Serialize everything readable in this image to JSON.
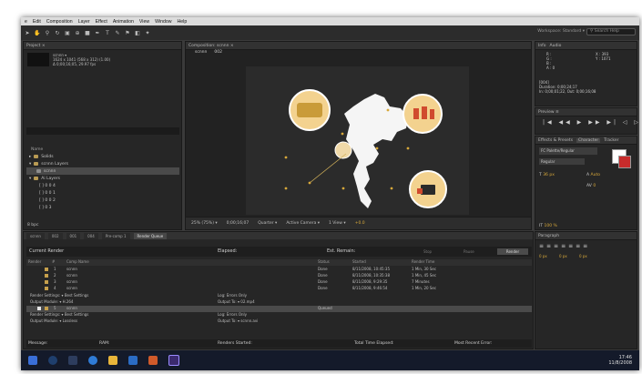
{
  "menu": [
    "e",
    "Edit",
    "Composition",
    "Layer",
    "Effect",
    "Animation",
    "View",
    "Window",
    "Help"
  ],
  "workspace": {
    "label": "Workspace:",
    "value": "Standard"
  },
  "search": {
    "placeholder": "Search Help"
  },
  "project": {
    "tab": "Project ×",
    "name": "scnnn ▾",
    "line1": "1624 x 1041 (568 x 312) (1.00)",
    "line2": "Δ 0;00;16;05, 29.97 fps",
    "column": "Name",
    "items": [
      {
        "label": "Solids",
        "type": "folder"
      },
      {
        "label": "scnnn Layers",
        "type": "folder"
      },
      {
        "label": "scnnn",
        "type": "comp",
        "selected": true
      },
      {
        "label": "Ai Layers",
        "type": "folder"
      },
      {
        "label": "[ ] 0 0 4",
        "type": "file"
      },
      {
        "label": "[ ] 0 0 1",
        "type": "file"
      },
      {
        "label": "[ ] 0 0 2",
        "type": "file"
      },
      {
        "label": "[ ] 0 3",
        "type": "file"
      }
    ],
    "footer": "8 bpc"
  },
  "composition": {
    "tab": "Composition: scnnn ×",
    "subtabs": [
      "scnnn",
      "002"
    ],
    "bottom": [
      "25% (75%) ▾",
      "0;00;16;07",
      "Quarter ▾",
      "Active Camera ▾",
      "1 View ▾",
      "+0.0"
    ]
  },
  "info": {
    "tabs": [
      "Info",
      "Audio"
    ],
    "r": "R :",
    "g": "G :",
    "b": "B :",
    "a": "A : 0",
    "x": "X : 393",
    "y": "Y : 1071",
    "line1": "[004]",
    "line2": "Duration: 0;00;24;17",
    "line3": "In: 0;00;01;22, Out: 0;00;16;08"
  },
  "preview": {
    "tab": "Preview ≡",
    "controls": "|◀ ◀◀ ▶ ▶▶ ▶| ◁ ▷"
  },
  "character": {
    "tabs": [
      "Effects & Presets",
      "Character",
      "Tracker"
    ],
    "font": "FC Palette/Regular",
    "style": "Regular",
    "size": "36 px",
    "leading": "Auto",
    "tracking": "0",
    "scale": "100 %"
  },
  "paragraph": {
    "tab": "Paragraph",
    "indent1": "0 px",
    "indent2": "0 px",
    "indent3": "0 px"
  },
  "render": {
    "tabs": [
      "scnnn",
      "002",
      "001",
      "004",
      "Pre-comp 1",
      "Render Queue"
    ],
    "current_render": "Current Render",
    "elapsed": "Elapsed:",
    "remain": "Est. Remain:",
    "stop": "Stop",
    "pause": "Pause",
    "render_btn": "Render",
    "columns": [
      "Render",
      "#",
      "Comp Name",
      "Status",
      "Started",
      "Render Time"
    ],
    "rows": [
      {
        "num": "1",
        "name": "scnnn",
        "status": "Done",
        "started": "8/11/2008, 10:45:35",
        "time": "1 Min, 30 Sec"
      },
      {
        "num": "2",
        "name": "scnnn",
        "status": "Done",
        "started": "8/11/2008, 10:35:38",
        "time": "1 Min, 45 Sec"
      },
      {
        "num": "3",
        "name": "scnnn",
        "status": "Done",
        "started": "8/11/2008, 9:29:35",
        "time": "7 Minutes"
      },
      {
        "num": "4",
        "name": "scnnn",
        "status": "Done",
        "started": "8/11/2008, 9:46:54",
        "time": "1 Min, 20 Sec"
      }
    ],
    "settings1": "Render Settings: ▾ Best Settings",
    "output1": "Output Module: ▾ H.264",
    "log1": "Log: Errors Only",
    "outto1": "Output To: ▾ 02.mp4",
    "row5": {
      "num": "5",
      "name": "scnnn",
      "status": "Queued"
    },
    "settings2": "Render Settings: ▾ Best Settings",
    "output2": "Output Module: ▾ Lossless",
    "log2": "Log: Errors Only",
    "outto2": "Output To: ▾ scnnn.avi",
    "footer": [
      "Message:",
      "RAM:",
      "Renders Started:",
      "Total Time Elapsed:",
      "Most Recent Error:"
    ]
  },
  "clock": {
    "time": "17:46",
    "date": "11/8/2008"
  }
}
